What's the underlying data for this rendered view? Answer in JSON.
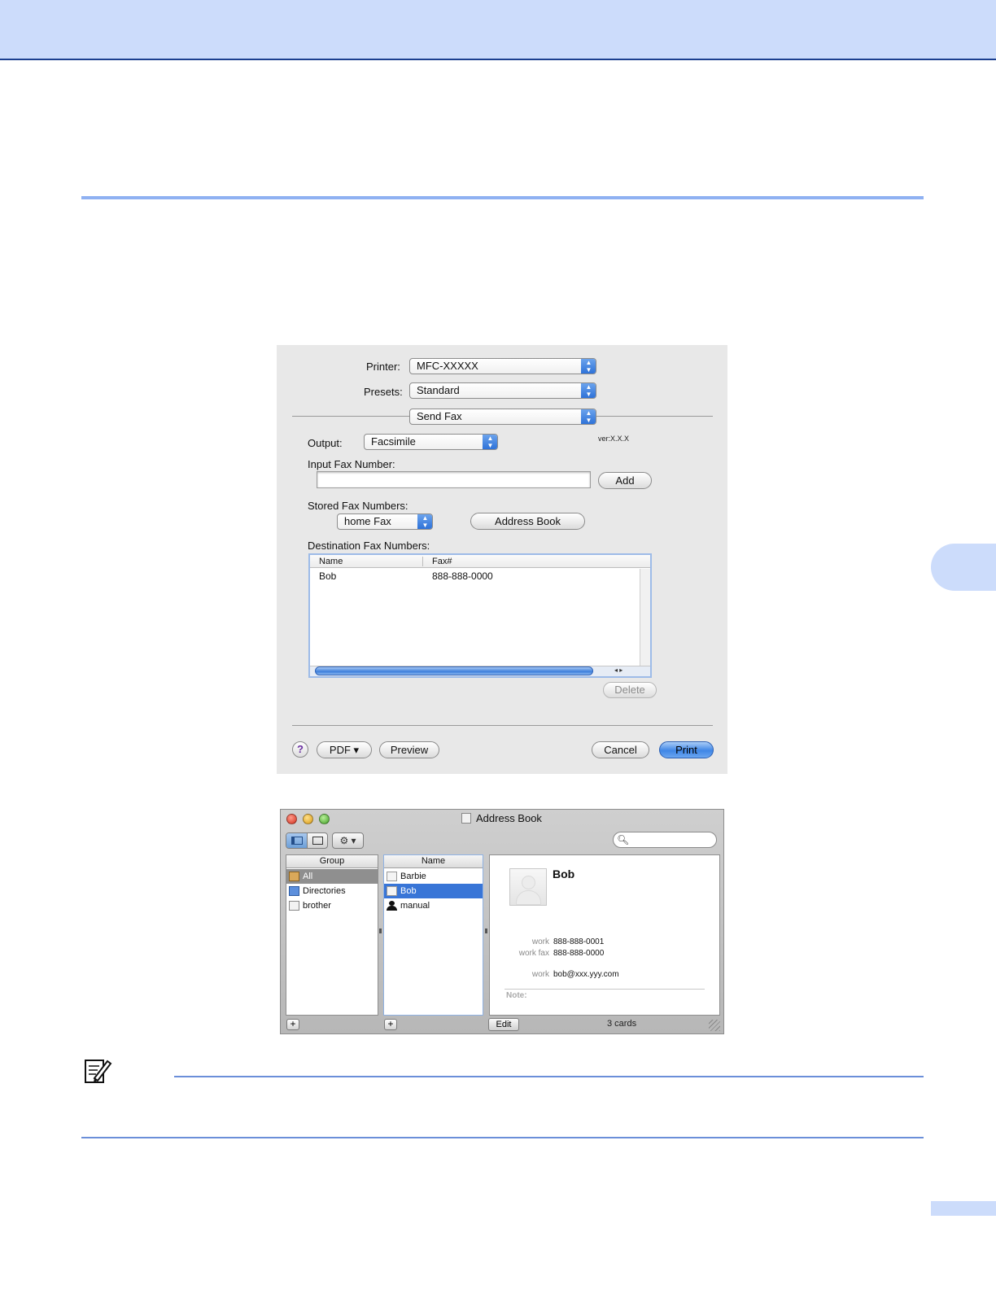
{
  "print_dialog": {
    "printer_label": "Printer:",
    "printer_value": "MFC-XXXXX",
    "presets_label": "Presets:",
    "presets_value": "Standard",
    "panel_value": "Send Fax",
    "output_label": "Output:",
    "output_value": "Facsimile",
    "version": "ver:X.X.X",
    "input_fax_label": "Input Fax Number:",
    "input_fax_value": "",
    "add_label": "Add",
    "stored_label": "Stored Fax Numbers:",
    "stored_value": "home Fax",
    "address_book_label": "Address Book",
    "destination_label": "Destination Fax Numbers:",
    "table": {
      "headers": [
        "Name",
        "Fax#"
      ],
      "rows": [
        [
          "Bob",
          "888-888-0000"
        ]
      ]
    },
    "delete_label": "Delete",
    "help_glyph": "?",
    "pdf_label": "PDF ▾",
    "preview_label": "Preview",
    "cancel_label": "Cancel",
    "print_label": "Print"
  },
  "address_book": {
    "title": "Address Book",
    "group_header": "Group",
    "groups": [
      "All",
      "Directories",
      "brother"
    ],
    "name_header": "Name",
    "names": [
      "Barbie",
      "Bob",
      "manual"
    ],
    "card": {
      "name": "Bob",
      "phone_label": "work",
      "phone_value": "888-888-0001",
      "fax_label": "work fax",
      "fax_value": "888-888-0000",
      "email_label": "work",
      "email_value": "bob@xxx.yyy.com",
      "note_label": "Note:"
    },
    "edit_label": "Edit",
    "card_count": "3 cards",
    "plus_glyph": "+"
  },
  "colors": {
    "accent_blue": "#3875d7",
    "band_blue": "#ccdcfb"
  }
}
